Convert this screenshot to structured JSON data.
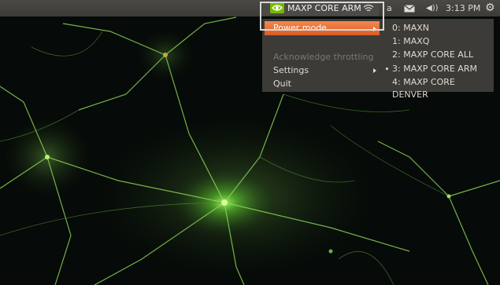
{
  "panel": {
    "indicator_label": "MAXP CORE ARM",
    "partial_letter": "a",
    "clock": "3:13 PM",
    "volume_glyph": "◀))"
  },
  "menu": {
    "items": [
      {
        "label": "Power mode",
        "has_submenu": true,
        "selected": true
      },
      {
        "label": "Acknowledge throttling",
        "disabled": true
      },
      {
        "label": "Settings",
        "has_submenu": true
      },
      {
        "label": "Quit"
      }
    ]
  },
  "power_modes": [
    {
      "label": "0: MAXN",
      "active": false
    },
    {
      "label": "1: MAXQ",
      "active": false
    },
    {
      "label": "2: MAXP CORE ALL",
      "active": false
    },
    {
      "label": "3: MAXP CORE ARM",
      "active": true
    },
    {
      "label": "4: MAXP CORE DENVER",
      "active": false
    }
  ],
  "icons": {
    "nvidia": "nvidia-logo-icon",
    "wifi": "wifi-icon",
    "mail": "mail-icon",
    "volume": "volume-icon",
    "settings": "gear-icon"
  },
  "colors": {
    "accent": "#e9672f",
    "panel": "#3c3b37",
    "nvidia_green": "#76b900"
  }
}
